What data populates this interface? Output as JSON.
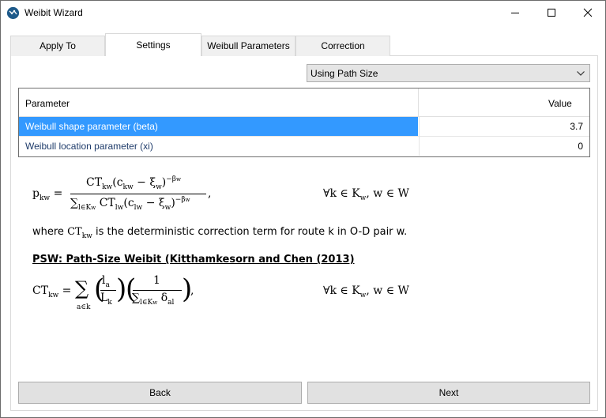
{
  "window": {
    "title": "Weibit Wizard",
    "icon": "weibit-app-icon"
  },
  "tabs": [
    {
      "label": "Apply To",
      "active": false
    },
    {
      "label": "Settings",
      "active": true
    },
    {
      "label": "Weibull Parameters",
      "active": false
    },
    {
      "label": "Correction",
      "active": false
    }
  ],
  "correction_type": {
    "selected": "Using Path Size"
  },
  "table": {
    "columns": [
      "Parameter",
      "Value"
    ],
    "rows": [
      {
        "parameter": "Weibull shape parameter (beta)",
        "value": "3.7",
        "selected": true
      },
      {
        "parameter": "Weibull location parameter (xi)",
        "value": "0",
        "selected": false
      }
    ]
  },
  "content": {
    "description": "where CT_kw is the deterministic correction term for route k in O-D pair w.",
    "description_parts": [
      "where ",
      "CT",
      "kw",
      " is the deterministic correction term for route k in O-D pair w."
    ],
    "psw_heading": "PSW: Path-Size Weibit (Kitthamkesorn and Chen (2013)",
    "eq1_condition": "∀k ∈ K_w, w ∈ W",
    "eq2_condition": "∀k ∈ K_w, w ∈ W"
  },
  "buttons": {
    "back": "Back",
    "next": "Next"
  },
  "colors": {
    "selection": "#3399ff",
    "row_text": "#1f3c6b"
  }
}
